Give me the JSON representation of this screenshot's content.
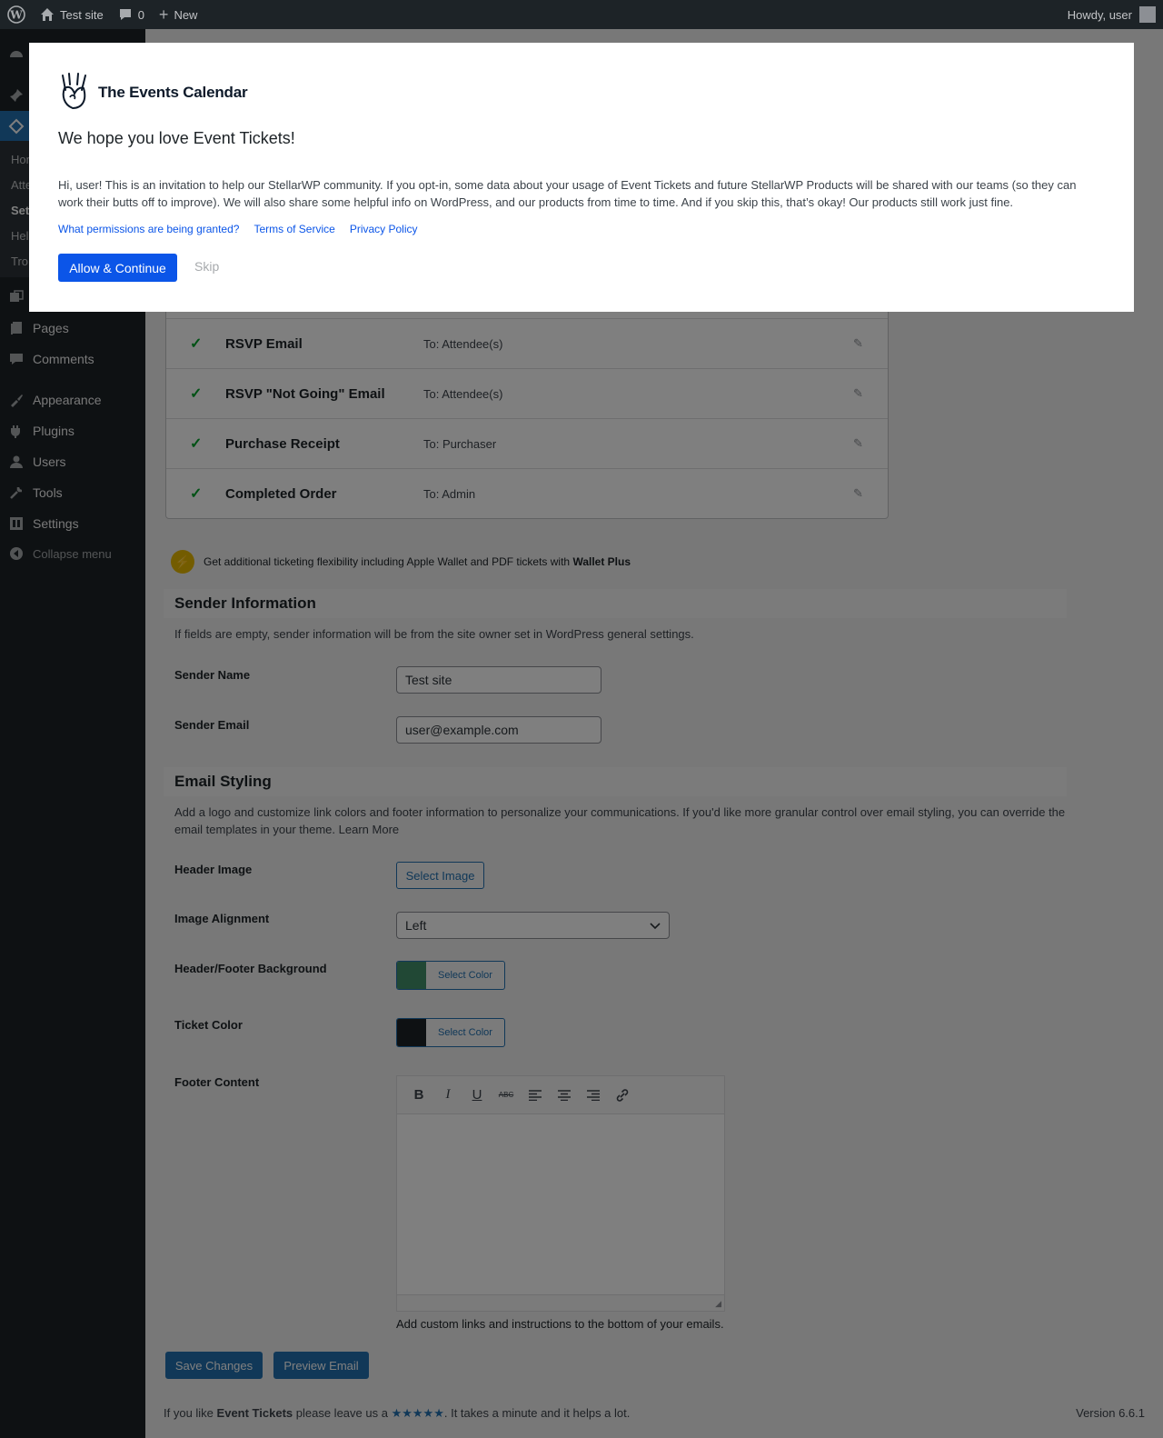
{
  "adminbar": {
    "site_name": "Test site",
    "comments_count": "0",
    "new_label": "New",
    "howdy": "Howdy, user"
  },
  "sidebar": {
    "submenu": [
      "Hom",
      "Atte",
      "Set",
      "Hel",
      "Tro"
    ],
    "items": [
      {
        "label": "Pages",
        "icon": "pages-icon"
      },
      {
        "label": "Comments",
        "icon": "comments-icon"
      },
      {
        "label": "Appearance",
        "icon": "appearance-icon"
      },
      {
        "label": "Plugins",
        "icon": "plugins-icon"
      },
      {
        "label": "Users",
        "icon": "users-icon"
      },
      {
        "label": "Tools",
        "icon": "tools-icon"
      },
      {
        "label": "Settings",
        "icon": "settings-icon"
      }
    ],
    "collapse": "Collapse menu"
  },
  "emails": [
    {
      "title": "RSVP Email",
      "to": "To: Attendee(s)"
    },
    {
      "title": "RSVP \"Not Going\" Email",
      "to": "To: Attendee(s)"
    },
    {
      "title": "Purchase Receipt",
      "to": "To: Purchaser"
    },
    {
      "title": "Completed Order",
      "to": "To: Admin"
    }
  ],
  "upsell": {
    "text": "Get additional ticketing flexibility including Apple Wallet and PDF tickets with",
    "strong": "Wallet Plus"
  },
  "sender": {
    "heading": "Sender Information",
    "description": "If fields are empty, sender information will be from the site owner set in WordPress general settings.",
    "name_label": "Sender Name",
    "name_value": "Test site",
    "email_label": "Sender Email",
    "email_value": "user@example.com"
  },
  "styling": {
    "heading": "Email Styling",
    "description": "Add a logo and customize link colors and footer information to personalize your communications. If you'd like more granular control over email styling, you can override the email templates in your theme.",
    "learn_more": "Learn More",
    "header_image_label": "Header Image",
    "select_image": "Select Image",
    "alignment_label": "Image Alignment",
    "alignment_value": "Left",
    "bg_label": "Header/Footer Background",
    "bg_color": "#42916a",
    "ticket_color_label": "Ticket Color",
    "ticket_color": "#1d2327",
    "select_color": "Select Color",
    "footer_label": "Footer Content",
    "footer_help": "Add custom links and instructions to the bottom of your emails."
  },
  "actions": {
    "save": "Save Changes",
    "preview": "Preview Email"
  },
  "footer": {
    "prefix": "If you like",
    "product": "Event Tickets",
    "middle": "please leave us a",
    "stars": "★★★★★",
    "suffix": ". It takes a minute and it helps a lot.",
    "version": "Version 6.6.1"
  },
  "modal": {
    "brand": "The Events Calendar",
    "title": "We hope you love Event Tickets!",
    "text": "Hi, user! This is an invitation to help our StellarWP community. If you opt-in, some data about your usage of Event Tickets and future StellarWP Products will be shared with our teams (so they can work their butts off to improve). We will also share some helpful info on WordPress, and our products from time to time. And if you skip this, that’s okay! Our products still work just fine.",
    "links": [
      "What permissions are being granted?",
      "Terms of Service",
      "Privacy Policy"
    ],
    "allow": "Allow & Continue",
    "skip": "Skip"
  },
  "colors": {
    "accent": "#2271b1",
    "modal_accent": "#0b55e8",
    "check": "#00a32a"
  }
}
